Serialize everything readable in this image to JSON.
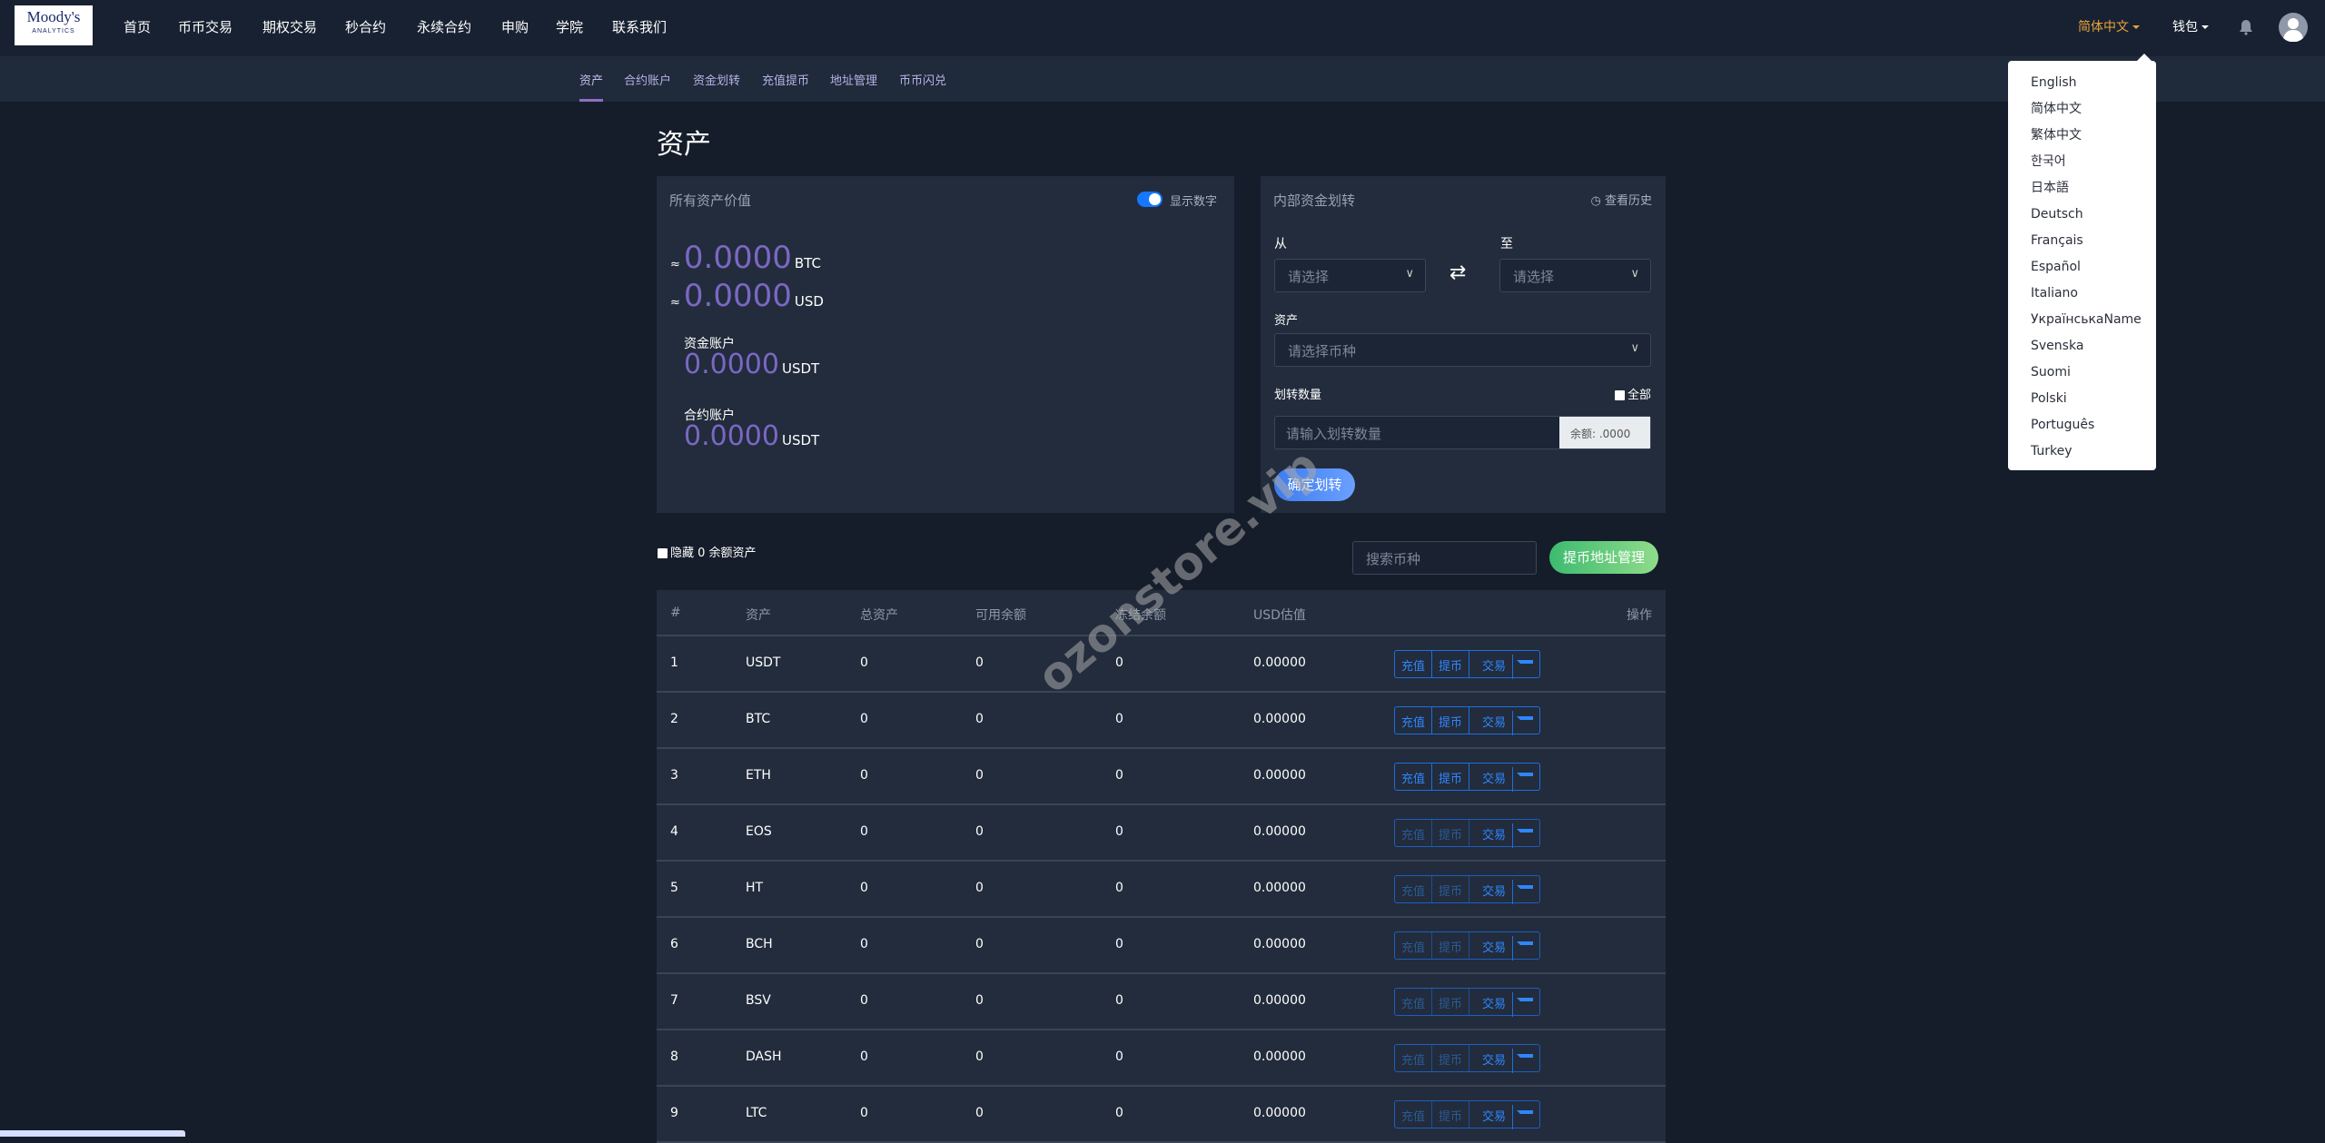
{
  "logo": {
    "line1": "Moody's",
    "line2": "ANALYTICS"
  },
  "nav": [
    "首页",
    "币币交易",
    "期权交易",
    "秒合约",
    "永续合约",
    "申购",
    "学院",
    "联系我们"
  ],
  "right_nav": {
    "language": "简体中文",
    "wallet": "钱包",
    "language_color": "#e8a33a"
  },
  "subnav": [
    "资产",
    "合约账户",
    "资金划转",
    "充值提币",
    "地址管理",
    "币币闪兑"
  ],
  "page_title": "资产",
  "assets_card": {
    "title": "所有资产价值",
    "toggle_label": "显示数字",
    "toggle_on": true,
    "approx": "≈",
    "btc_value": "0.0000",
    "btc_unit": "BTC",
    "usd_value": "0.0000",
    "usd_unit": "USD",
    "fund_label": "资金账户",
    "fund_value": "0.0000",
    "fund_unit": "USDT",
    "contract_label": "合约账户",
    "contract_value": "0.0000",
    "contract_unit": "USDT"
  },
  "transfer_card": {
    "title": "内部资金划转",
    "history": "查看历史",
    "from_label": "从",
    "to_label": "至",
    "from_placeholder": "请选择",
    "to_placeholder": "请选择",
    "asset_label": "资产",
    "asset_placeholder": "请选择币种",
    "amount_label": "划转数量",
    "all_label": "全部",
    "amount_placeholder": "请输入划转数量",
    "balance": "余额: .0000",
    "confirm": "确定划转"
  },
  "hide_zero": "隐藏 0 余额资产",
  "search_placeholder": "搜索币种",
  "address_btn": "提币地址管理",
  "table": {
    "headers": [
      "#",
      "资产",
      "总资产",
      "可用余额",
      "冻结余额",
      "USD估值",
      "操作"
    ],
    "actions": {
      "deposit": "充值",
      "withdraw": "提币",
      "trade": "交易"
    },
    "rows": [
      {
        "n": "1",
        "asset": "USDT",
        "total": "0",
        "available": "0",
        "frozen": "0",
        "usd": "0.00000",
        "enabled": true
      },
      {
        "n": "2",
        "asset": "BTC",
        "total": "0",
        "available": "0",
        "frozen": "0",
        "usd": "0.00000",
        "enabled": true
      },
      {
        "n": "3",
        "asset": "ETH",
        "total": "0",
        "available": "0",
        "frozen": "0",
        "usd": "0.00000",
        "enabled": true
      },
      {
        "n": "4",
        "asset": "EOS",
        "total": "0",
        "available": "0",
        "frozen": "0",
        "usd": "0.00000",
        "enabled": false
      },
      {
        "n": "5",
        "asset": "HT",
        "total": "0",
        "available": "0",
        "frozen": "0",
        "usd": "0.00000",
        "enabled": false
      },
      {
        "n": "6",
        "asset": "BCH",
        "total": "0",
        "available": "0",
        "frozen": "0",
        "usd": "0.00000",
        "enabled": false
      },
      {
        "n": "7",
        "asset": "BSV",
        "total": "0",
        "available": "0",
        "frozen": "0",
        "usd": "0.00000",
        "enabled": false
      },
      {
        "n": "8",
        "asset": "DASH",
        "total": "0",
        "available": "0",
        "frozen": "0",
        "usd": "0.00000",
        "enabled": false
      },
      {
        "n": "9",
        "asset": "LTC",
        "total": "0",
        "available": "0",
        "frozen": "0",
        "usd": "0.00000",
        "enabled": false
      }
    ]
  },
  "languages": [
    "English",
    "简体中文",
    "繁体中文",
    "한국어",
    "日本語",
    "Deutsch",
    "Français",
    "Español",
    "Italiano",
    "УкраїнськаName",
    "Svenska",
    "Suomi",
    "Polski",
    "Português",
    "Turkey"
  ],
  "watermark": "ozonstore.vip"
}
